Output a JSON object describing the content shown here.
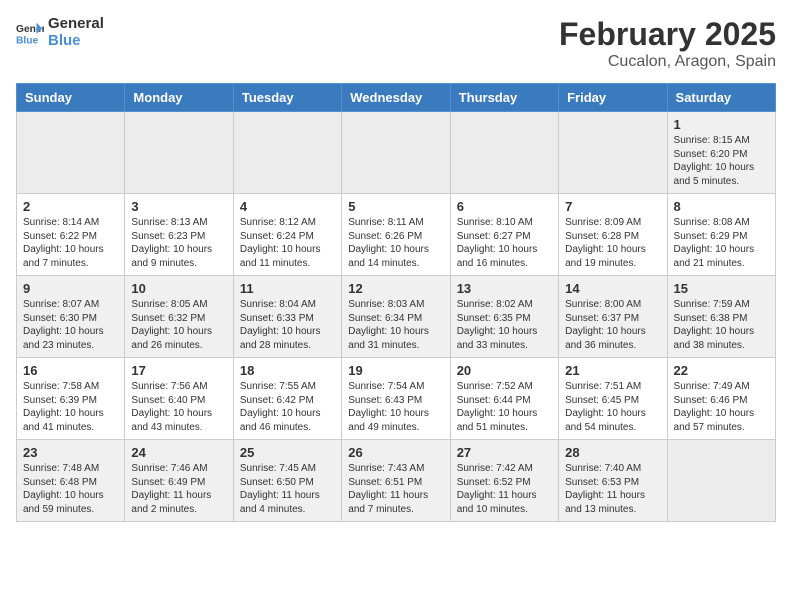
{
  "header": {
    "logo_line1": "General",
    "logo_line2": "Blue",
    "month_year": "February 2025",
    "location": "Cucalon, Aragon, Spain"
  },
  "weekdays": [
    "Sunday",
    "Monday",
    "Tuesday",
    "Wednesday",
    "Thursday",
    "Friday",
    "Saturday"
  ],
  "weeks": [
    [
      {
        "day": "",
        "info": ""
      },
      {
        "day": "",
        "info": ""
      },
      {
        "day": "",
        "info": ""
      },
      {
        "day": "",
        "info": ""
      },
      {
        "day": "",
        "info": ""
      },
      {
        "day": "",
        "info": ""
      },
      {
        "day": "1",
        "info": "Sunrise: 8:15 AM\nSunset: 6:20 PM\nDaylight: 10 hours and 5 minutes."
      }
    ],
    [
      {
        "day": "2",
        "info": "Sunrise: 8:14 AM\nSunset: 6:22 PM\nDaylight: 10 hours and 7 minutes."
      },
      {
        "day": "3",
        "info": "Sunrise: 8:13 AM\nSunset: 6:23 PM\nDaylight: 10 hours and 9 minutes."
      },
      {
        "day": "4",
        "info": "Sunrise: 8:12 AM\nSunset: 6:24 PM\nDaylight: 10 hours and 11 minutes."
      },
      {
        "day": "5",
        "info": "Sunrise: 8:11 AM\nSunset: 6:26 PM\nDaylight: 10 hours and 14 minutes."
      },
      {
        "day": "6",
        "info": "Sunrise: 8:10 AM\nSunset: 6:27 PM\nDaylight: 10 hours and 16 minutes."
      },
      {
        "day": "7",
        "info": "Sunrise: 8:09 AM\nSunset: 6:28 PM\nDaylight: 10 hours and 19 minutes."
      },
      {
        "day": "8",
        "info": "Sunrise: 8:08 AM\nSunset: 6:29 PM\nDaylight: 10 hours and 21 minutes."
      }
    ],
    [
      {
        "day": "9",
        "info": "Sunrise: 8:07 AM\nSunset: 6:30 PM\nDaylight: 10 hours and 23 minutes."
      },
      {
        "day": "10",
        "info": "Sunrise: 8:05 AM\nSunset: 6:32 PM\nDaylight: 10 hours and 26 minutes."
      },
      {
        "day": "11",
        "info": "Sunrise: 8:04 AM\nSunset: 6:33 PM\nDaylight: 10 hours and 28 minutes."
      },
      {
        "day": "12",
        "info": "Sunrise: 8:03 AM\nSunset: 6:34 PM\nDaylight: 10 hours and 31 minutes."
      },
      {
        "day": "13",
        "info": "Sunrise: 8:02 AM\nSunset: 6:35 PM\nDaylight: 10 hours and 33 minutes."
      },
      {
        "day": "14",
        "info": "Sunrise: 8:00 AM\nSunset: 6:37 PM\nDaylight: 10 hours and 36 minutes."
      },
      {
        "day": "15",
        "info": "Sunrise: 7:59 AM\nSunset: 6:38 PM\nDaylight: 10 hours and 38 minutes."
      }
    ],
    [
      {
        "day": "16",
        "info": "Sunrise: 7:58 AM\nSunset: 6:39 PM\nDaylight: 10 hours and 41 minutes."
      },
      {
        "day": "17",
        "info": "Sunrise: 7:56 AM\nSunset: 6:40 PM\nDaylight: 10 hours and 43 minutes."
      },
      {
        "day": "18",
        "info": "Sunrise: 7:55 AM\nSunset: 6:42 PM\nDaylight: 10 hours and 46 minutes."
      },
      {
        "day": "19",
        "info": "Sunrise: 7:54 AM\nSunset: 6:43 PM\nDaylight: 10 hours and 49 minutes."
      },
      {
        "day": "20",
        "info": "Sunrise: 7:52 AM\nSunset: 6:44 PM\nDaylight: 10 hours and 51 minutes."
      },
      {
        "day": "21",
        "info": "Sunrise: 7:51 AM\nSunset: 6:45 PM\nDaylight: 10 hours and 54 minutes."
      },
      {
        "day": "22",
        "info": "Sunrise: 7:49 AM\nSunset: 6:46 PM\nDaylight: 10 hours and 57 minutes."
      }
    ],
    [
      {
        "day": "23",
        "info": "Sunrise: 7:48 AM\nSunset: 6:48 PM\nDaylight: 10 hours and 59 minutes."
      },
      {
        "day": "24",
        "info": "Sunrise: 7:46 AM\nSunset: 6:49 PM\nDaylight: 11 hours and 2 minutes."
      },
      {
        "day": "25",
        "info": "Sunrise: 7:45 AM\nSunset: 6:50 PM\nDaylight: 11 hours and 4 minutes."
      },
      {
        "day": "26",
        "info": "Sunrise: 7:43 AM\nSunset: 6:51 PM\nDaylight: 11 hours and 7 minutes."
      },
      {
        "day": "27",
        "info": "Sunrise: 7:42 AM\nSunset: 6:52 PM\nDaylight: 11 hours and 10 minutes."
      },
      {
        "day": "28",
        "info": "Sunrise: 7:40 AM\nSunset: 6:53 PM\nDaylight: 11 hours and 13 minutes."
      },
      {
        "day": "",
        "info": ""
      }
    ]
  ]
}
